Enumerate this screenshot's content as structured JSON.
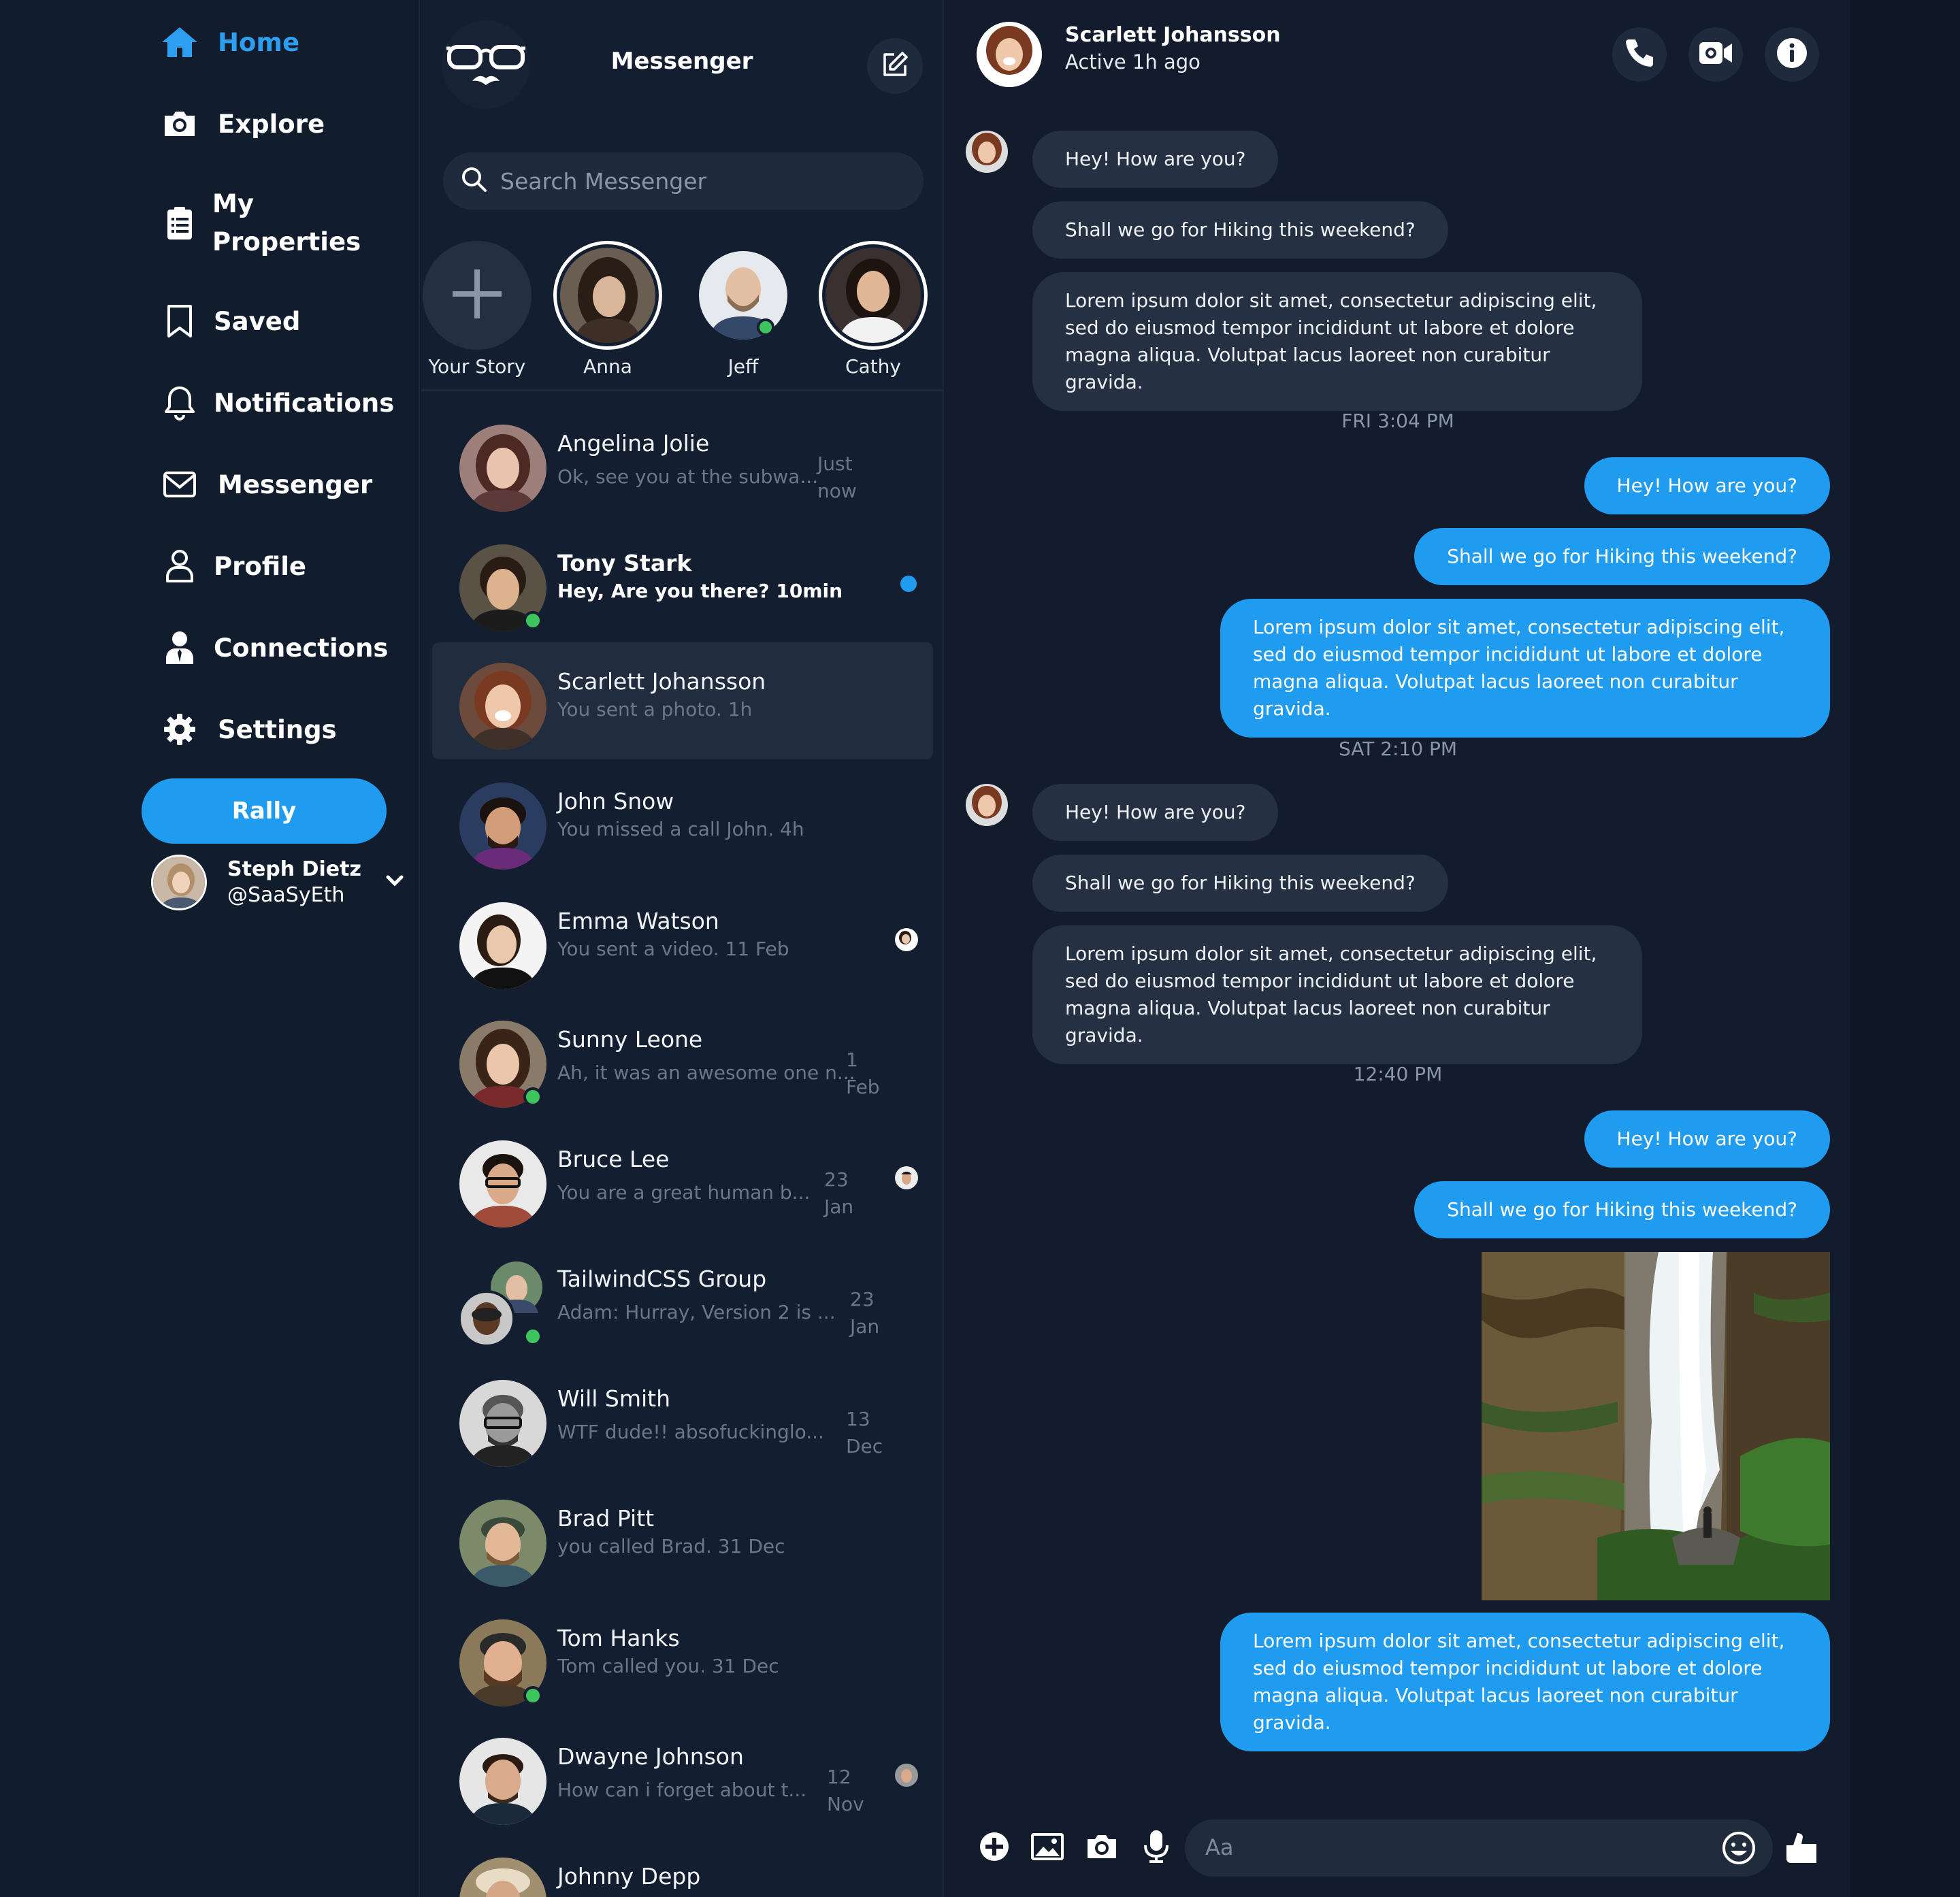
{
  "sidebar": {
    "nav": [
      {
        "label": "Home",
        "icon": "home-icon",
        "active": true
      },
      {
        "label": "Explore",
        "icon": "camera-icon"
      },
      {
        "label": "My",
        "label2": "Properties",
        "icon": "clipboard-icon"
      },
      {
        "label": "Saved",
        "icon": "bookmark-icon"
      },
      {
        "label": "Notifications",
        "icon": "bell-icon"
      },
      {
        "label": "Messenger",
        "icon": "envelope-icon"
      },
      {
        "label": "Profile",
        "icon": "user-icon"
      },
      {
        "label": "Connections",
        "icon": "user-tie-icon"
      },
      {
        "label": "Settings",
        "icon": "gear-icon"
      }
    ],
    "cta_label": "Rally",
    "user": {
      "name": "Steph Dietz",
      "handle": "@SaaSyEth"
    }
  },
  "messenger": {
    "title": "Messenger",
    "search_placeholder": "Search Messenger",
    "stories": [
      {
        "label": "Your Story"
      },
      {
        "label": "Anna"
      },
      {
        "label": "Jeff"
      },
      {
        "label": "Cathy"
      }
    ],
    "conversations": [
      {
        "name": "Angelina Jolie",
        "preview": "Ok, see you at the subwa...",
        "time1": "Just",
        "time2": "now"
      },
      {
        "name": "Tony Stark",
        "preview": "Hey, Are you there?  10min"
      },
      {
        "name": "Scarlett Johansson",
        "preview": "You sent a photo.  1h"
      },
      {
        "name": "John Snow",
        "preview": "You missed a call John.  4h"
      },
      {
        "name": "Emma Watson",
        "preview": "You sent a video.  11 Feb"
      },
      {
        "name": "Sunny Leone",
        "preview": "Ah, it was an awesome one n...",
        "time1": "1",
        "time2": "Feb"
      },
      {
        "name": "Bruce Lee",
        "preview": "You are a great human b...",
        "time1": "23",
        "time2": "Jan"
      },
      {
        "name": "TailwindCSS Group",
        "preview": "Adam: Hurray, Version 2 is ...",
        "time1": "23",
        "time2": "Jan"
      },
      {
        "name": "Will Smith",
        "preview": "WTF dude!! absofuckinglo...",
        "time1": "13",
        "time2": "Dec"
      },
      {
        "name": "Brad Pitt",
        "preview": "you called Brad.  31 Dec"
      },
      {
        "name": "Tom Hanks",
        "preview": "Tom called you.  31 Dec"
      },
      {
        "name": "Dwayne Johnson",
        "preview": "How can i forget about t...",
        "time1": "12",
        "time2": "Nov"
      },
      {
        "name": "Johnny Depp",
        "preview": ""
      }
    ]
  },
  "chat": {
    "contact_name": "Scarlett Johansson",
    "contact_status": "Active 1h ago",
    "m_hey": "Hey! How are you?",
    "m_hike": "Shall we go for Hiking this weekend?",
    "m_lorem": "Lorem ipsum dolor sit amet, consectetur adipiscing elit, sed do eiusmod tempor incididunt ut labore et dolore magna aliqua. Volutpat lacus laoreet non curabitur gravida.",
    "ts1": "FRI 3:04 PM",
    "ts2": "SAT 2:10 PM",
    "ts3": "12:40 PM",
    "input_placeholder": "Aa"
  },
  "colors": {
    "accent": "#1f9bf0",
    "background": "#0f1a2a",
    "online": "#3ec45c"
  }
}
